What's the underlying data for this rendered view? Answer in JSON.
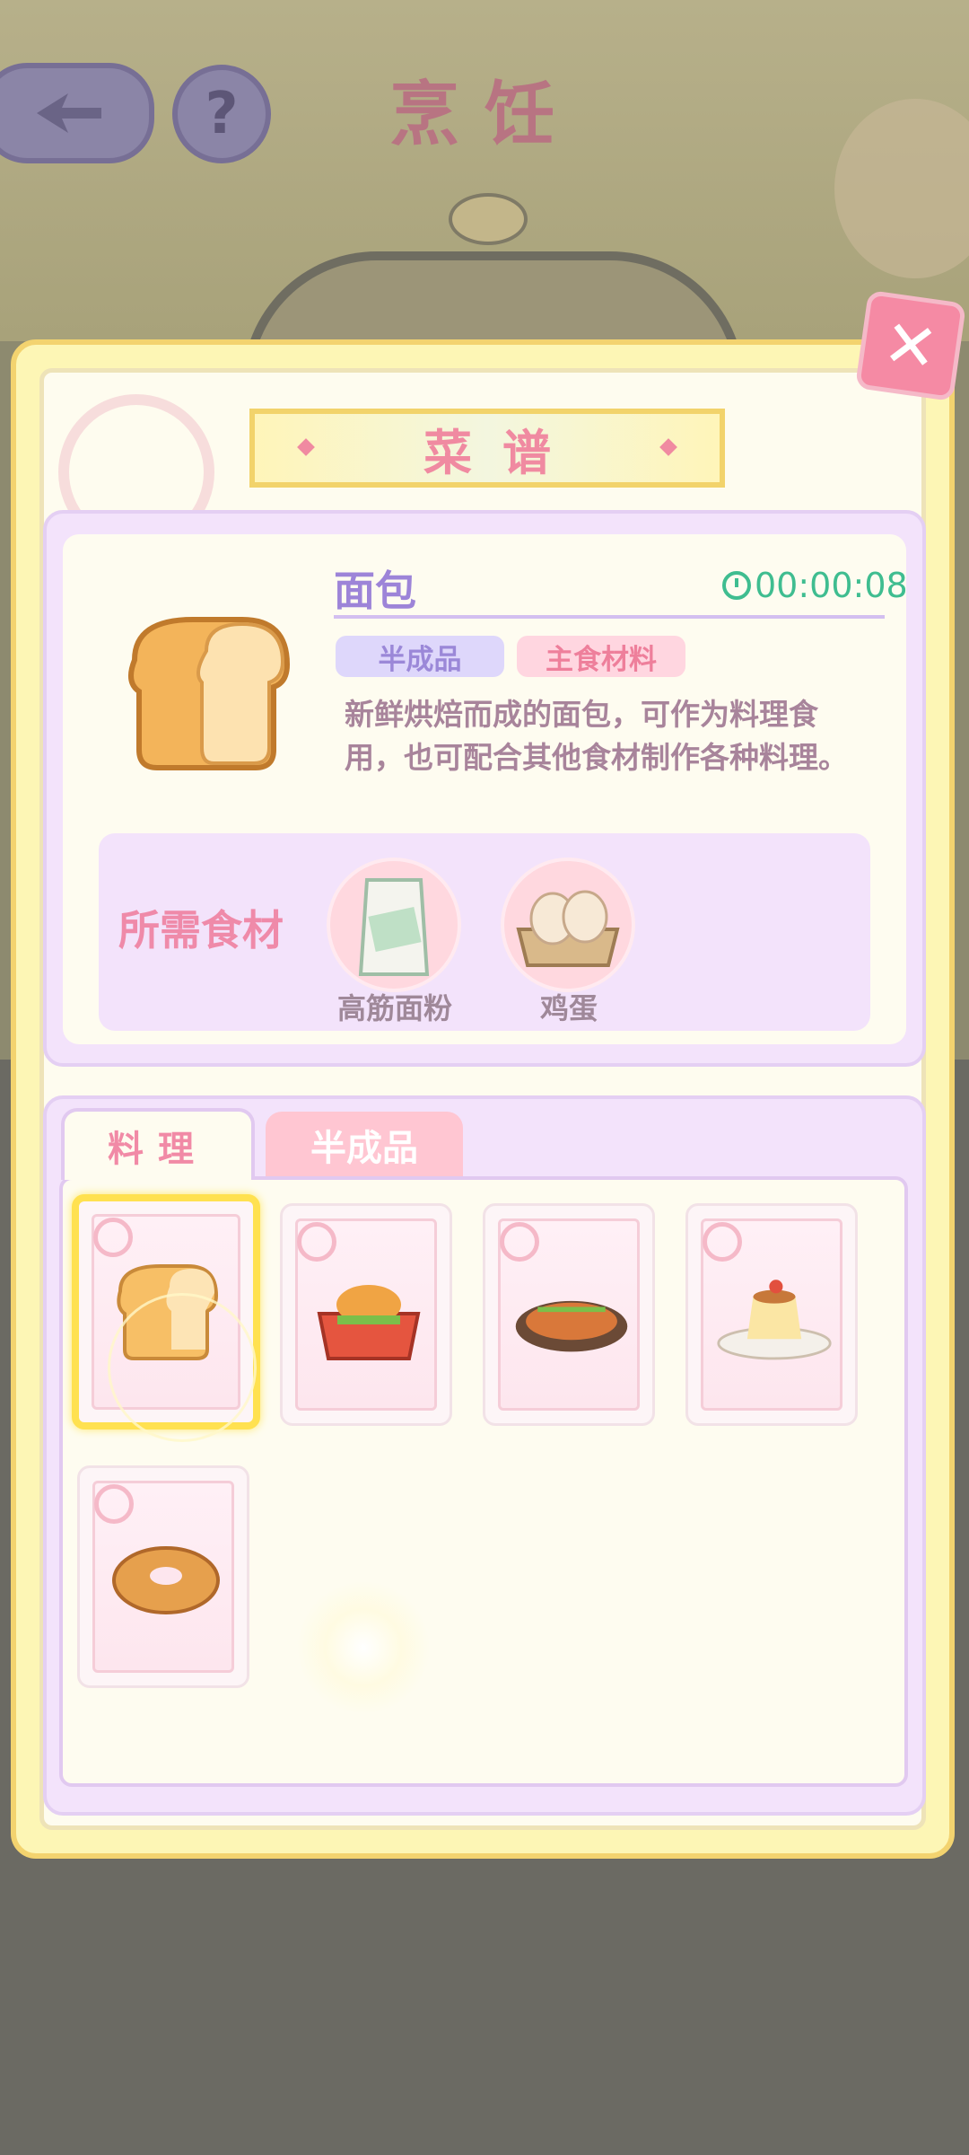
{
  "header": {
    "title": "烹饪"
  },
  "dialog": {
    "title": "菜谱",
    "item": {
      "name": "面包",
      "time": "00:00:08",
      "tags": [
        "半成品",
        "主食材料"
      ],
      "description": "新鲜烘焙而成的面包，可作为料理食用，也可配合其他食材制作各种料理。"
    },
    "ingredients": {
      "title": "所需食材",
      "items": [
        {
          "label": "高筋面粉",
          "icon": "flour-icon"
        },
        {
          "label": "鸡蛋",
          "icon": "eggs-icon"
        }
      ]
    },
    "tabs": [
      "料理",
      "半成品"
    ],
    "recipes": [
      {
        "icon": "bread-icon",
        "selected": true
      },
      {
        "icon": "burger-box-icon"
      },
      {
        "icon": "grilled-chicken-icon"
      },
      {
        "icon": "pudding-icon"
      },
      {
        "icon": "donut-icon"
      }
    ]
  },
  "colors": {
    "accent": "#f08aa1",
    "title_purple": "#9d84d8",
    "time_green": "#3fbd90",
    "highlight": "#ffe150"
  }
}
